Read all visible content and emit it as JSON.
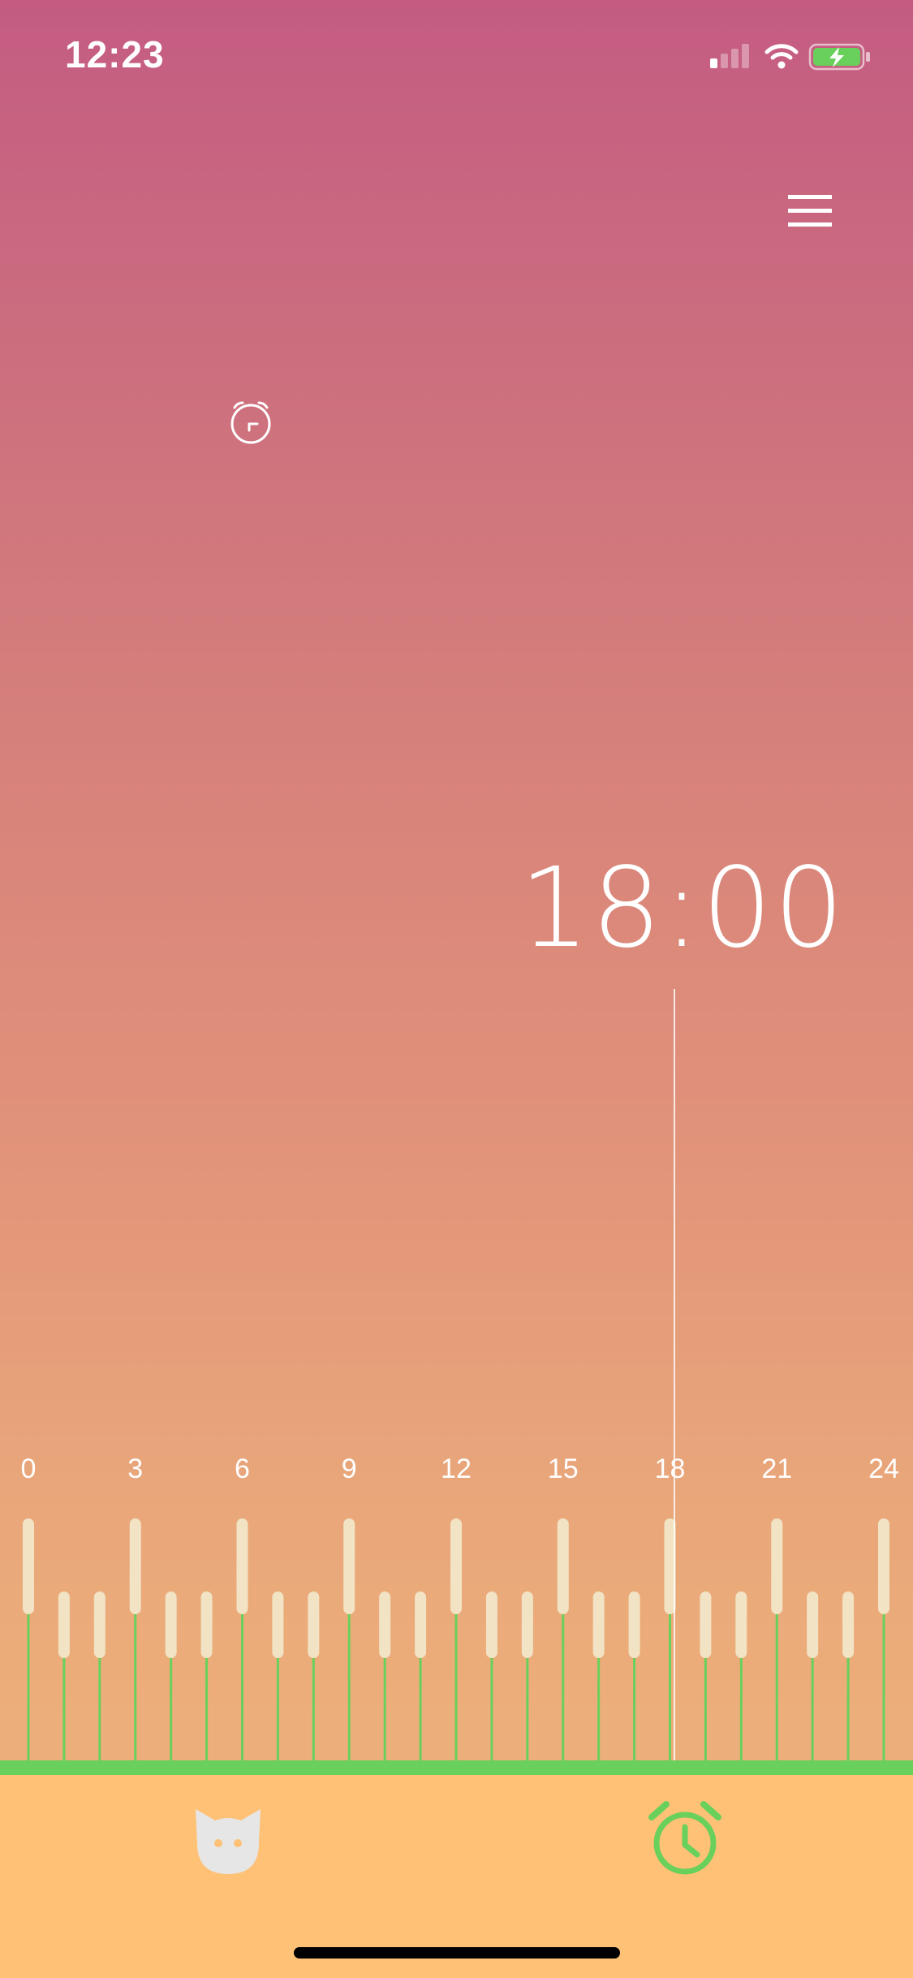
{
  "status_bar": {
    "time": "12:23",
    "icons": [
      "cellular-signal-icon",
      "wifi-icon",
      "battery-charging-icon"
    ]
  },
  "header": {
    "menu_icon": "hamburger-menu-icon",
    "alarm_icon": "alarm-clock-icon"
  },
  "selected_time": "18:00",
  "timeline": {
    "labels": [
      "0",
      "3",
      "6",
      "9",
      "12",
      "15",
      "18",
      "21",
      "24"
    ],
    "selected_hour": 18,
    "hour_count": 25
  },
  "tabbar": {
    "tabs": [
      {
        "icon": "cat-face-icon",
        "active": false
      },
      {
        "icon": "alarm-clock-icon",
        "active": true
      }
    ]
  },
  "colors": {
    "background_top": "#c45c82",
    "background_bottom": "#ecae7a",
    "accent_green": "#69d05c",
    "tabbar_background": "#ffc176",
    "tick_cream": "#f1e3c4",
    "inactive_icon": "#e6e6e6"
  }
}
